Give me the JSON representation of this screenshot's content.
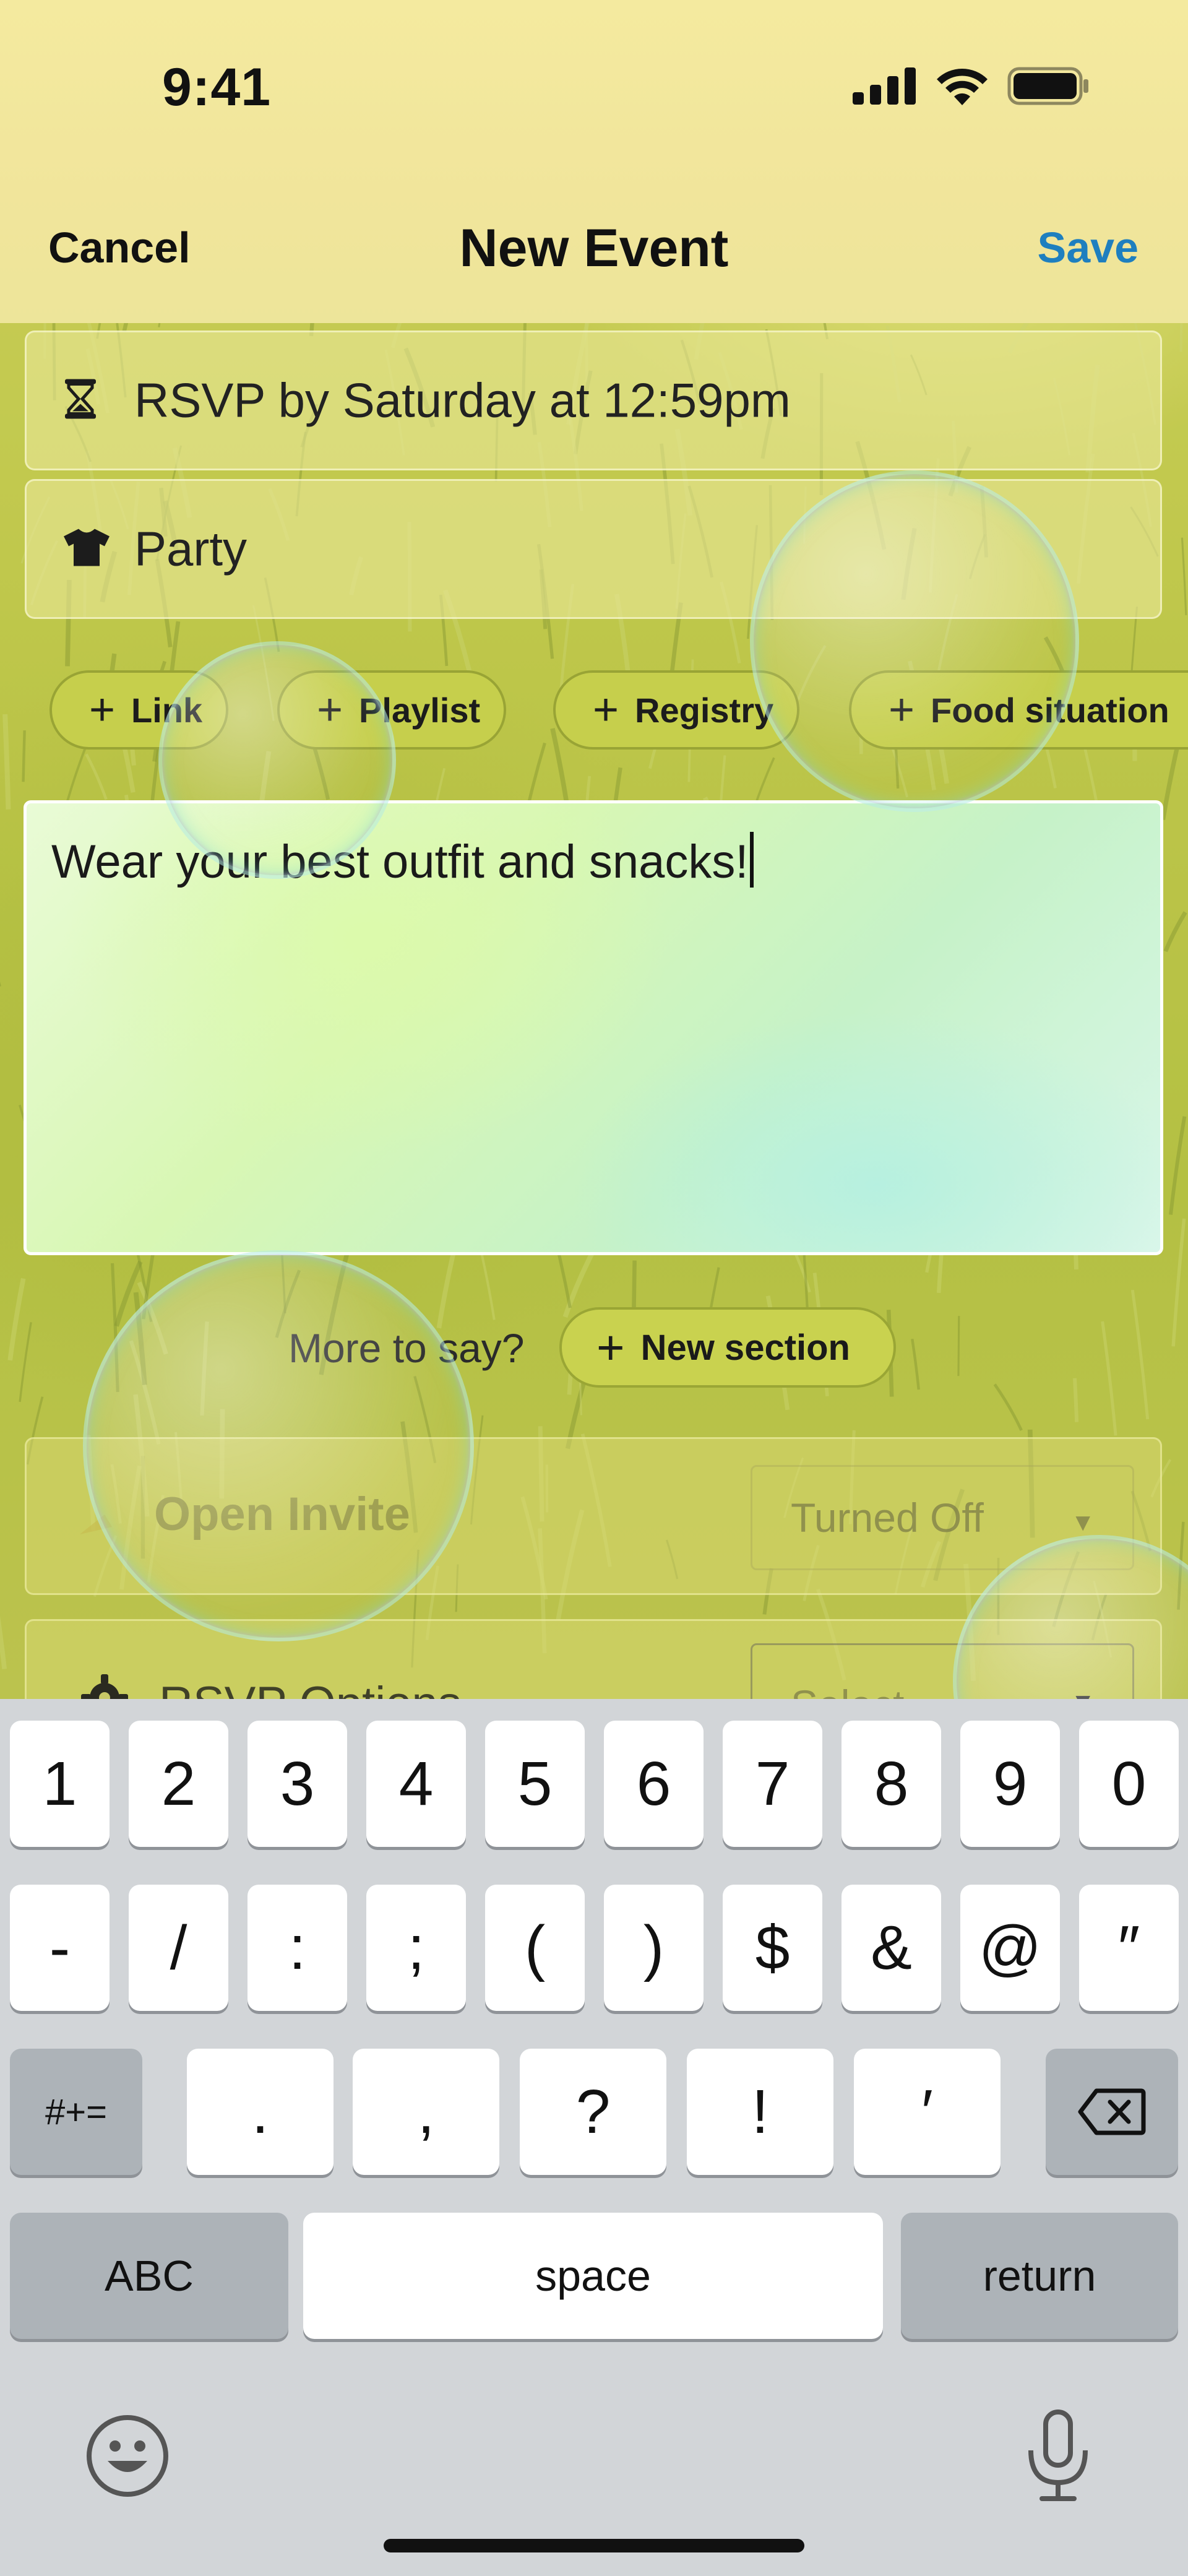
{
  "status_bar": {
    "time": "9:41"
  },
  "nav": {
    "cancel": "Cancel",
    "title": "New Event",
    "save": "Save"
  },
  "rows": [
    {
      "icon": "hourglass-icon",
      "text": "RSVP by Saturday at 12:59pm"
    },
    {
      "icon": "tshirt-icon",
      "text": "Party"
    }
  ],
  "chips": [
    "Link",
    "Playlist",
    "Registry",
    "Food situation"
  ],
  "description": {
    "text": "Wear your best outfit and snacks!"
  },
  "more": {
    "label": "More to say?",
    "button": "New section"
  },
  "open_invite": {
    "label": "Open Invite",
    "value": "Turned Off"
  },
  "rsvp_options": {
    "label": "RSVP Options",
    "value": "Select"
  },
  "keyboard": {
    "row1": [
      "1",
      "2",
      "3",
      "4",
      "5",
      "6",
      "7",
      "8",
      "9",
      "0"
    ],
    "row2": [
      "-",
      "/",
      ":",
      ";",
      "(",
      ")",
      "$",
      "&",
      "@",
      "″"
    ],
    "row3": [
      ".",
      ",",
      "?",
      "!",
      "′"
    ],
    "symbols": "#+=",
    "abc": "ABC",
    "space": "space",
    "return": "return"
  },
  "colors": {
    "accent": "#1e7fbf",
    "chip": "#c6cf4c",
    "header": "#f1e59b",
    "keyboard": "#d2d5d8"
  }
}
